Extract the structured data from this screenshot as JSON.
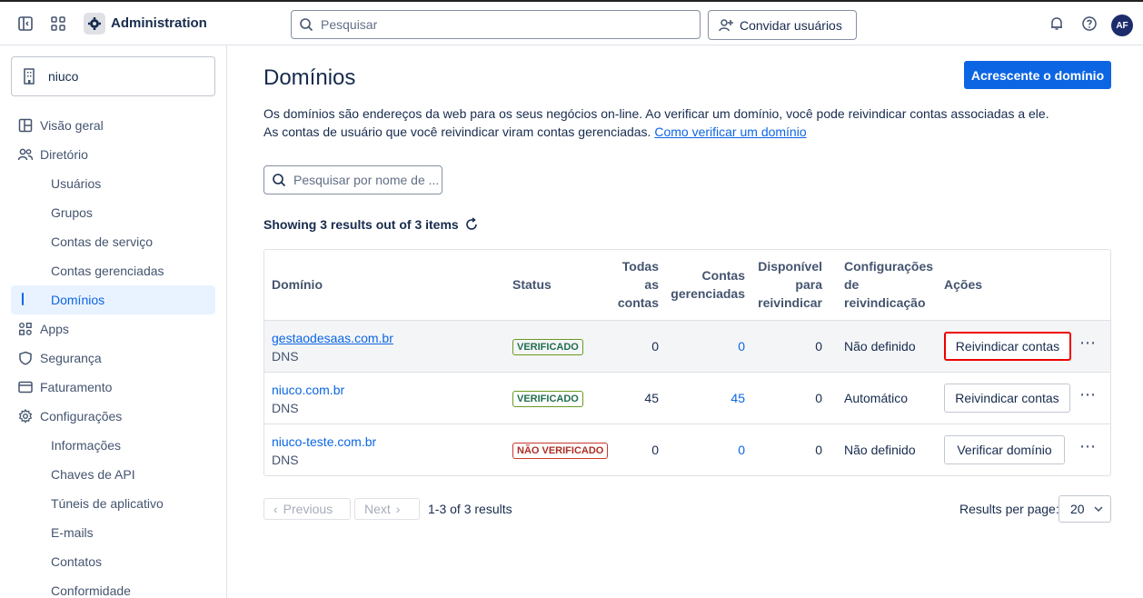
{
  "topbar": {
    "app_title": "Administration",
    "search_placeholder": "Pesquisar",
    "invite_label": "Convidar usuários",
    "avatar_initials": "AF"
  },
  "sidebar": {
    "org_name": "niuco",
    "items": [
      {
        "label": "Visão geral",
        "icon": "overview-icon"
      },
      {
        "label": "Diretório",
        "icon": "people-icon"
      },
      {
        "label": "Usuários"
      },
      {
        "label": "Grupos"
      },
      {
        "label": "Contas de serviço"
      },
      {
        "label": "Contas gerenciadas"
      },
      {
        "label": "Domínios"
      },
      {
        "label": "Apps",
        "icon": "apps-icon"
      },
      {
        "label": "Segurança",
        "icon": "shield-icon"
      },
      {
        "label": "Faturamento",
        "icon": "credit-card-icon"
      },
      {
        "label": "Configurações",
        "icon": "gear-icon"
      },
      {
        "label": "Informações"
      },
      {
        "label": "Chaves de API"
      },
      {
        "label": "Túneis de aplicativo"
      },
      {
        "label": "E-mails"
      },
      {
        "label": "Contatos"
      },
      {
        "label": "Conformidade"
      }
    ]
  },
  "main": {
    "title": "Domínios",
    "add_button": "Acrescente o domínio",
    "description": "Os domínios são endereços da web para os seus negócios on-line. Ao verificar um domínio, você pode reivindicar contas associadas a ele. As contas de usuário que você reivindicar viram contas gerenciadas.",
    "description_link": "Como verificar um domínio",
    "search_placeholder": "Pesquisar por nome de ...",
    "showing": "Showing 3 results out of 3 items"
  },
  "table": {
    "headers": {
      "domain": "Domínio",
      "status": "Status",
      "all_1": "Todas",
      "all_2": "as",
      "all_3": "contas",
      "managed_1": "Contas",
      "managed_2": "gerenciadas",
      "avail_1": "Disponível",
      "avail_2": "para",
      "avail_3": "reivindicar",
      "config_1": "Configurações",
      "config_2": "de",
      "config_3": "reivindicação",
      "actions": "Ações"
    },
    "rows": [
      {
        "domain": "gestaodesaas.com.br",
        "type": "DNS",
        "status": "VERIFICADO",
        "all": "0",
        "managed": "0",
        "available": "0",
        "config": "Não definido",
        "action": "Reivindicar contas"
      },
      {
        "domain": "niuco.com.br",
        "type": "DNS",
        "status": "VERIFICADO",
        "all": "45",
        "managed": "45",
        "available": "0",
        "config": "Automático",
        "action": "Reivindicar contas"
      },
      {
        "domain": "niuco-teste.com.br",
        "type": "DNS",
        "status": "NÃO VERIFICADO",
        "all": "0",
        "managed": "0",
        "available": "0",
        "config": "Não definido",
        "action": "Verificar domínio"
      }
    ]
  },
  "pagination": {
    "previous": "Previous",
    "next": "Next",
    "range": "1-3 of 3 results",
    "per_page_label": "Results per page:",
    "per_page_value": "20"
  },
  "colors": {
    "accent": "#0c66e4",
    "highlight_border": "#e00000"
  }
}
